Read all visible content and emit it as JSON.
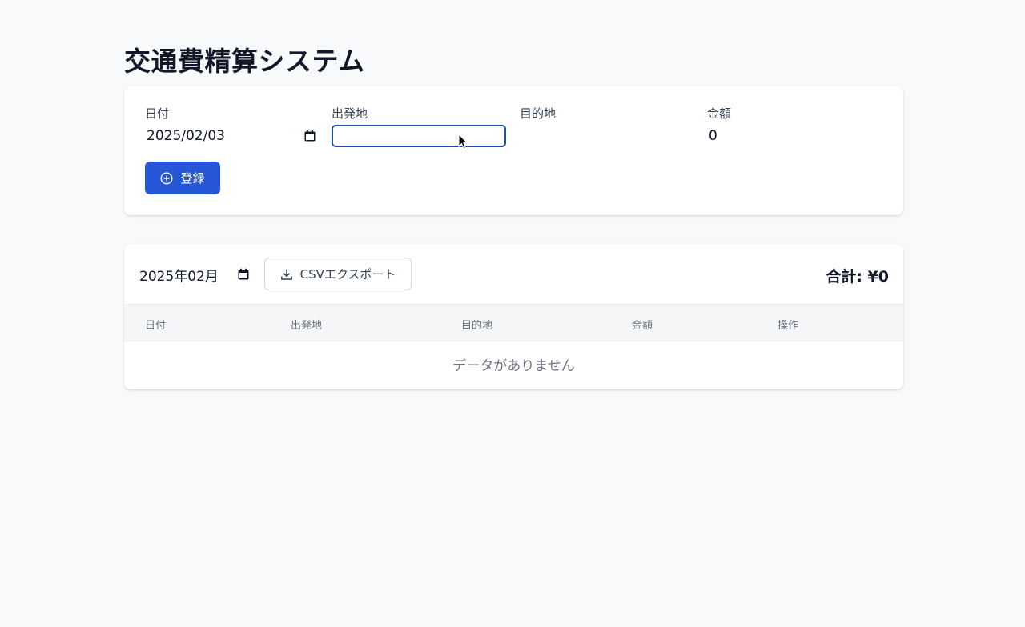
{
  "page": {
    "title": "交通費精算システム"
  },
  "form": {
    "date": {
      "label": "日付",
      "value": "2025/02/03"
    },
    "from": {
      "label": "出発地",
      "value": ""
    },
    "to": {
      "label": "目的地",
      "value": ""
    },
    "amount": {
      "label": "金額",
      "value": "0"
    },
    "submit_label": "登録"
  },
  "list": {
    "month_value": "2025年02月",
    "csv_label": "CSVエクスポート",
    "total_label": "合計: ",
    "total_value": "¥0",
    "columns": [
      "日付",
      "出発地",
      "目的地",
      "金額",
      "操作"
    ],
    "empty_message": "データがありません"
  },
  "icons": {
    "calendar": "calendar-icon",
    "plus_circle": "plus-circle-icon",
    "download": "download-icon",
    "cursor": "mouse-cursor"
  },
  "colors": {
    "primary": "#2557d6",
    "focus_border": "#1e4fa3",
    "background": "#f8f9fa"
  }
}
